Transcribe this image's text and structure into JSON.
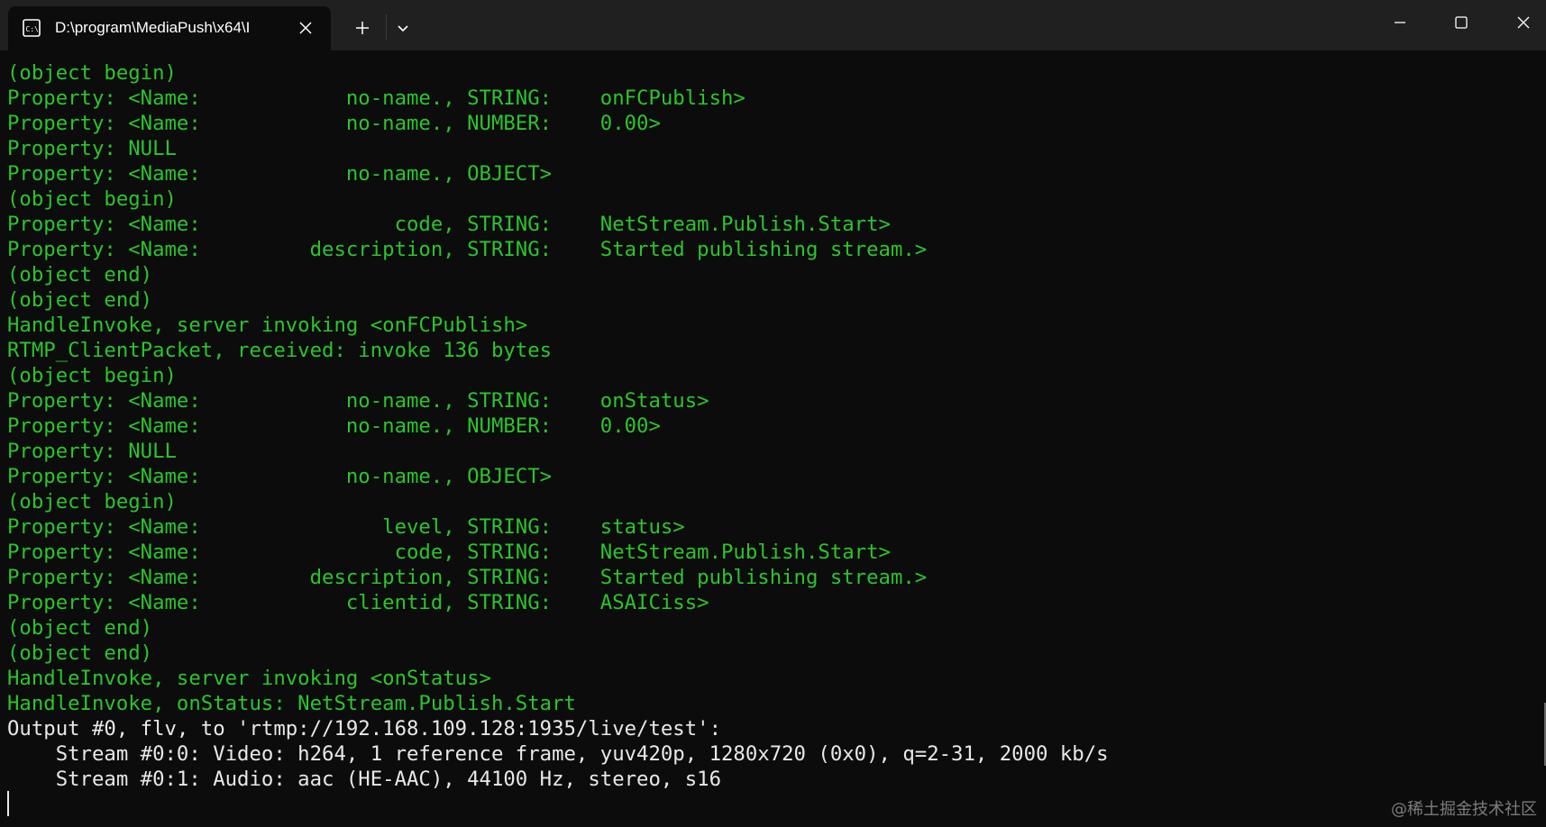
{
  "window": {
    "tab_title": "D:\\program\\MediaPush\\x64\\I",
    "tab_icon": "terminal-icon",
    "new_tab_icon": "plus-icon",
    "dropdown_icon": "chevron-down-icon",
    "minimize_icon": "minimize-icon",
    "maximize_icon": "maximize-icon",
    "close_icon": "close-icon",
    "tab_close_icon": "close-icon"
  },
  "colors": {
    "background": "#0c0c0c",
    "titlebar": "#202020",
    "green_text": "#2bc52b",
    "white_text": "#e8e8e8"
  },
  "terminal": {
    "lines": [
      {
        "text": "(object begin)",
        "color": "green"
      },
      {
        "text": "Property: <Name:            no-name., STRING:    onFCPublish>",
        "color": "green"
      },
      {
        "text": "Property: <Name:            no-name., NUMBER:    0.00>",
        "color": "green"
      },
      {
        "text": "Property: NULL",
        "color": "green"
      },
      {
        "text": "Property: <Name:            no-name., OBJECT>",
        "color": "green"
      },
      {
        "text": "(object begin)",
        "color": "green"
      },
      {
        "text": "Property: <Name:                code, STRING:    NetStream.Publish.Start>",
        "color": "green"
      },
      {
        "text": "Property: <Name:         description, STRING:    Started publishing stream.>",
        "color": "green"
      },
      {
        "text": "(object end)",
        "color": "green"
      },
      {
        "text": "(object end)",
        "color": "green"
      },
      {
        "text": "HandleInvoke, server invoking <onFCPublish>",
        "color": "green"
      },
      {
        "text": "RTMP_ClientPacket, received: invoke 136 bytes",
        "color": "green"
      },
      {
        "text": "(object begin)",
        "color": "green"
      },
      {
        "text": "Property: <Name:            no-name., STRING:    onStatus>",
        "color": "green"
      },
      {
        "text": "Property: <Name:            no-name., NUMBER:    0.00>",
        "color": "green"
      },
      {
        "text": "Property: NULL",
        "color": "green"
      },
      {
        "text": "Property: <Name:            no-name., OBJECT>",
        "color": "green"
      },
      {
        "text": "(object begin)",
        "color": "green"
      },
      {
        "text": "Property: <Name:               level, STRING:    status>",
        "color": "green"
      },
      {
        "text": "Property: <Name:                code, STRING:    NetStream.Publish.Start>",
        "color": "green"
      },
      {
        "text": "Property: <Name:         description, STRING:    Started publishing stream.>",
        "color": "green"
      },
      {
        "text": "Property: <Name:            clientid, STRING:    ASAICiss>",
        "color": "green"
      },
      {
        "text": "(object end)",
        "color": "green"
      },
      {
        "text": "(object end)",
        "color": "green"
      },
      {
        "text": "HandleInvoke, server invoking <onStatus>",
        "color": "green"
      },
      {
        "text": "HandleInvoke, onStatus: NetStream.Publish.Start",
        "color": "green"
      },
      {
        "text": "Output #0, flv, to 'rtmp://192.168.109.128:1935/live/test':",
        "color": "white"
      },
      {
        "text": "    Stream #0:0: Video: h264, 1 reference frame, yuv420p, 1280x720 (0x0), q=2-31, 2000 kb/s",
        "color": "white"
      },
      {
        "text": "    Stream #0:1: Audio: aac (HE-AAC), 44100 Hz, stereo, s16",
        "color": "white"
      }
    ]
  },
  "watermark": "@稀土掘金技术社区"
}
